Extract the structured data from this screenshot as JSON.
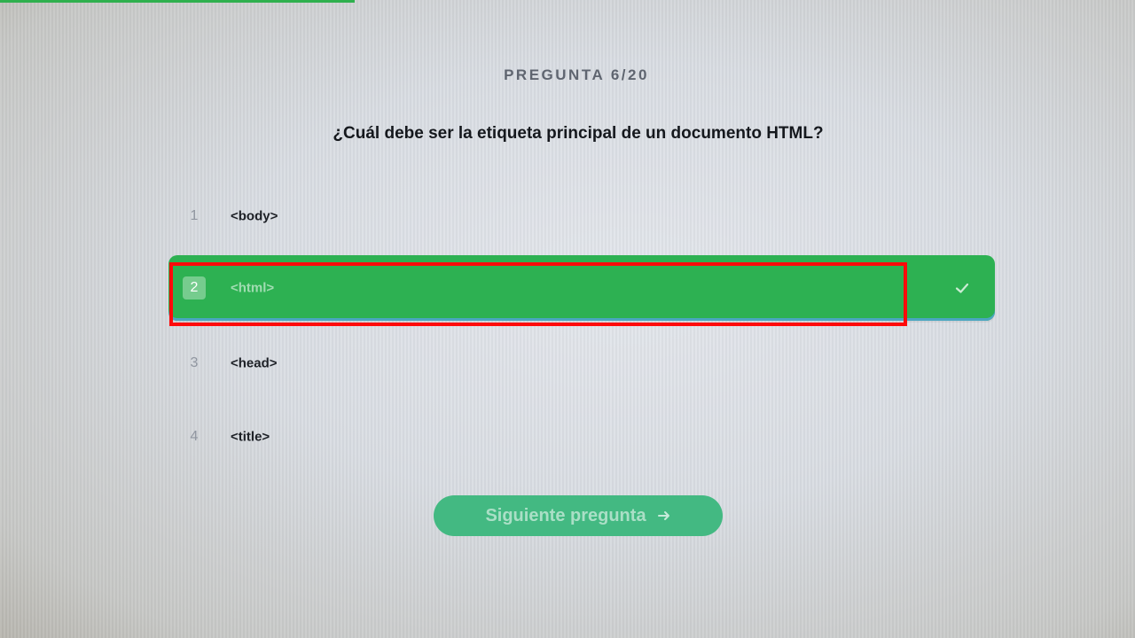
{
  "progress": 0.3,
  "question": {
    "counter": "PREGUNTA 6/20",
    "text": "¿Cuál debe ser la etiqueta principal de un documento HTML?"
  },
  "answers": [
    {
      "number": "1",
      "label": "<body>",
      "selected": false
    },
    {
      "number": "2",
      "label": "<html>",
      "selected": true
    },
    {
      "number": "3",
      "label": "<head>",
      "selected": false
    },
    {
      "number": "4",
      "label": "<title>",
      "selected": false
    }
  ],
  "next_button": {
    "label": "Siguiente pregunta",
    "icon": "arrow-right-icon"
  },
  "icons": {
    "selected_answer": "check-icon"
  },
  "colors": {
    "selected_answer": "#2db152",
    "next_button": "#43b982",
    "highlight_box": "#ff0a0a",
    "progress_bar": "#2fb04e"
  }
}
